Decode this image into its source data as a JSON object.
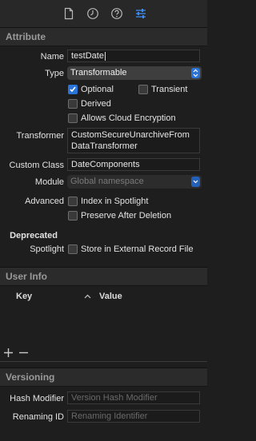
{
  "toolbar": {
    "icons": [
      "document-icon",
      "clock-icon",
      "help-icon",
      "sliders-icon"
    ]
  },
  "attribute": {
    "title": "Attribute",
    "name_label": "Name",
    "name_value": "testDate",
    "type_label": "Type",
    "type_value": "Transformable",
    "optional_label": "Optional",
    "optional_checked": true,
    "transient_label": "Transient",
    "transient_checked": false,
    "derived_label": "Derived",
    "derived_checked": false,
    "cloud_label": "Allows Cloud Encryption",
    "cloud_checked": false,
    "transformer_label": "Transformer",
    "transformer_value_line1": "CustomSecureUnarchiveFrom",
    "transformer_value_line2": "DataTransformer",
    "custom_class_label": "Custom Class",
    "custom_class_value": "DateComponents",
    "module_label": "Module",
    "module_placeholder": "Global namespace",
    "advanced_label": "Advanced",
    "index_label": "Index in Spotlight",
    "index_checked": false,
    "preserve_label": "Preserve After Deletion",
    "preserve_checked": false,
    "deprecated_label": "Deprecated",
    "spotlight_label": "Spotlight",
    "store_label": "Store in External Record File",
    "store_checked": false
  },
  "user_info": {
    "title": "User Info",
    "col_key": "Key",
    "col_value": "Value"
  },
  "versioning": {
    "title": "Versioning",
    "hash_label": "Hash Modifier",
    "hash_placeholder": "Version Hash Modifier",
    "renaming_label": "Renaming ID",
    "renaming_placeholder": "Renaming Identifier"
  },
  "colors": {
    "accent": "#2a73d9",
    "background": "#1e1e1e"
  }
}
